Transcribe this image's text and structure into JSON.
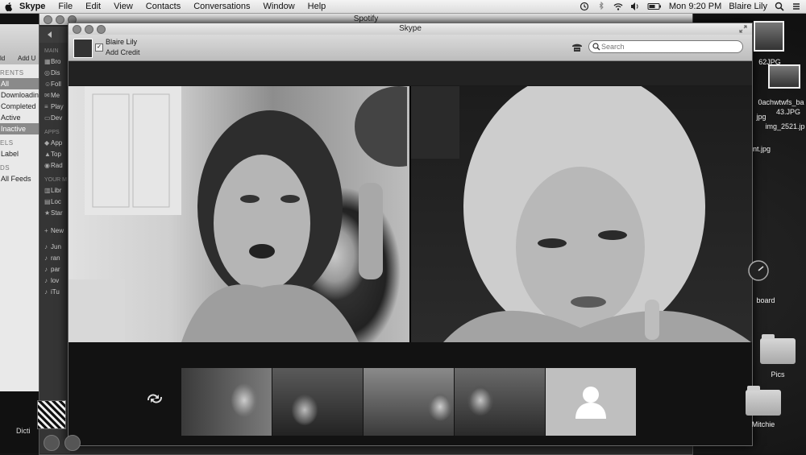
{
  "menubar": {
    "app_name": "Skype",
    "menus": [
      "File",
      "Edit",
      "View",
      "Contacts",
      "Conversations",
      "Window",
      "Help"
    ],
    "clock": "Mon 9:20 PM",
    "user": "Blaire Lily"
  },
  "background_window": {
    "toolbar_labels": [
      "ld",
      "Add U"
    ],
    "sections": [
      {
        "title": "RENTS",
        "items": [
          {
            "label": "All",
            "selected": true
          },
          {
            "label": "Downloading",
            "selected": false
          },
          {
            "label": "Completed",
            "selected": false
          },
          {
            "label": "Active",
            "selected": false
          },
          {
            "label": "Inactive",
            "selected": true
          }
        ]
      },
      {
        "title": "ELS",
        "items": [
          {
            "label": "Label",
            "selected": false
          }
        ]
      },
      {
        "title": "DS",
        "items": [
          {
            "label": "All Feeds",
            "selected": false
          }
        ]
      }
    ]
  },
  "spotify": {
    "title": "Spotify",
    "sidebar": {
      "main_title": "MAIN",
      "main_items": [
        "Bro",
        "Dis",
        "Foll",
        "Me",
        "Play",
        "Dev"
      ],
      "apps_title": "APPS",
      "apps_items": [
        "App",
        "Top",
        "Rad"
      ],
      "your_music_title": "YOUR M",
      "your_music_items": [
        "Libr",
        "Loc",
        "Star"
      ],
      "new_label": "New",
      "playlists": [
        "Jun",
        "ran",
        "par",
        "lov",
        "iTu"
      ]
    }
  },
  "skype": {
    "title": "Skype",
    "user_name": "Blaire Lily",
    "add_credit": "Add Credit",
    "search_placeholder": "Search"
  },
  "desktop": {
    "icons": [
      "62JPG",
      "0achwtwfs_ba",
      "43.JPG",
      "jpg",
      "img_2521.jp",
      "nt.jpg",
      "board",
      "Pics",
      "Mitchie",
      "Dicti"
    ]
  },
  "colors": {
    "window_chrome": "#d0d0d0",
    "skype_bg": "#1a1a1a",
    "desktop": "#151515"
  }
}
